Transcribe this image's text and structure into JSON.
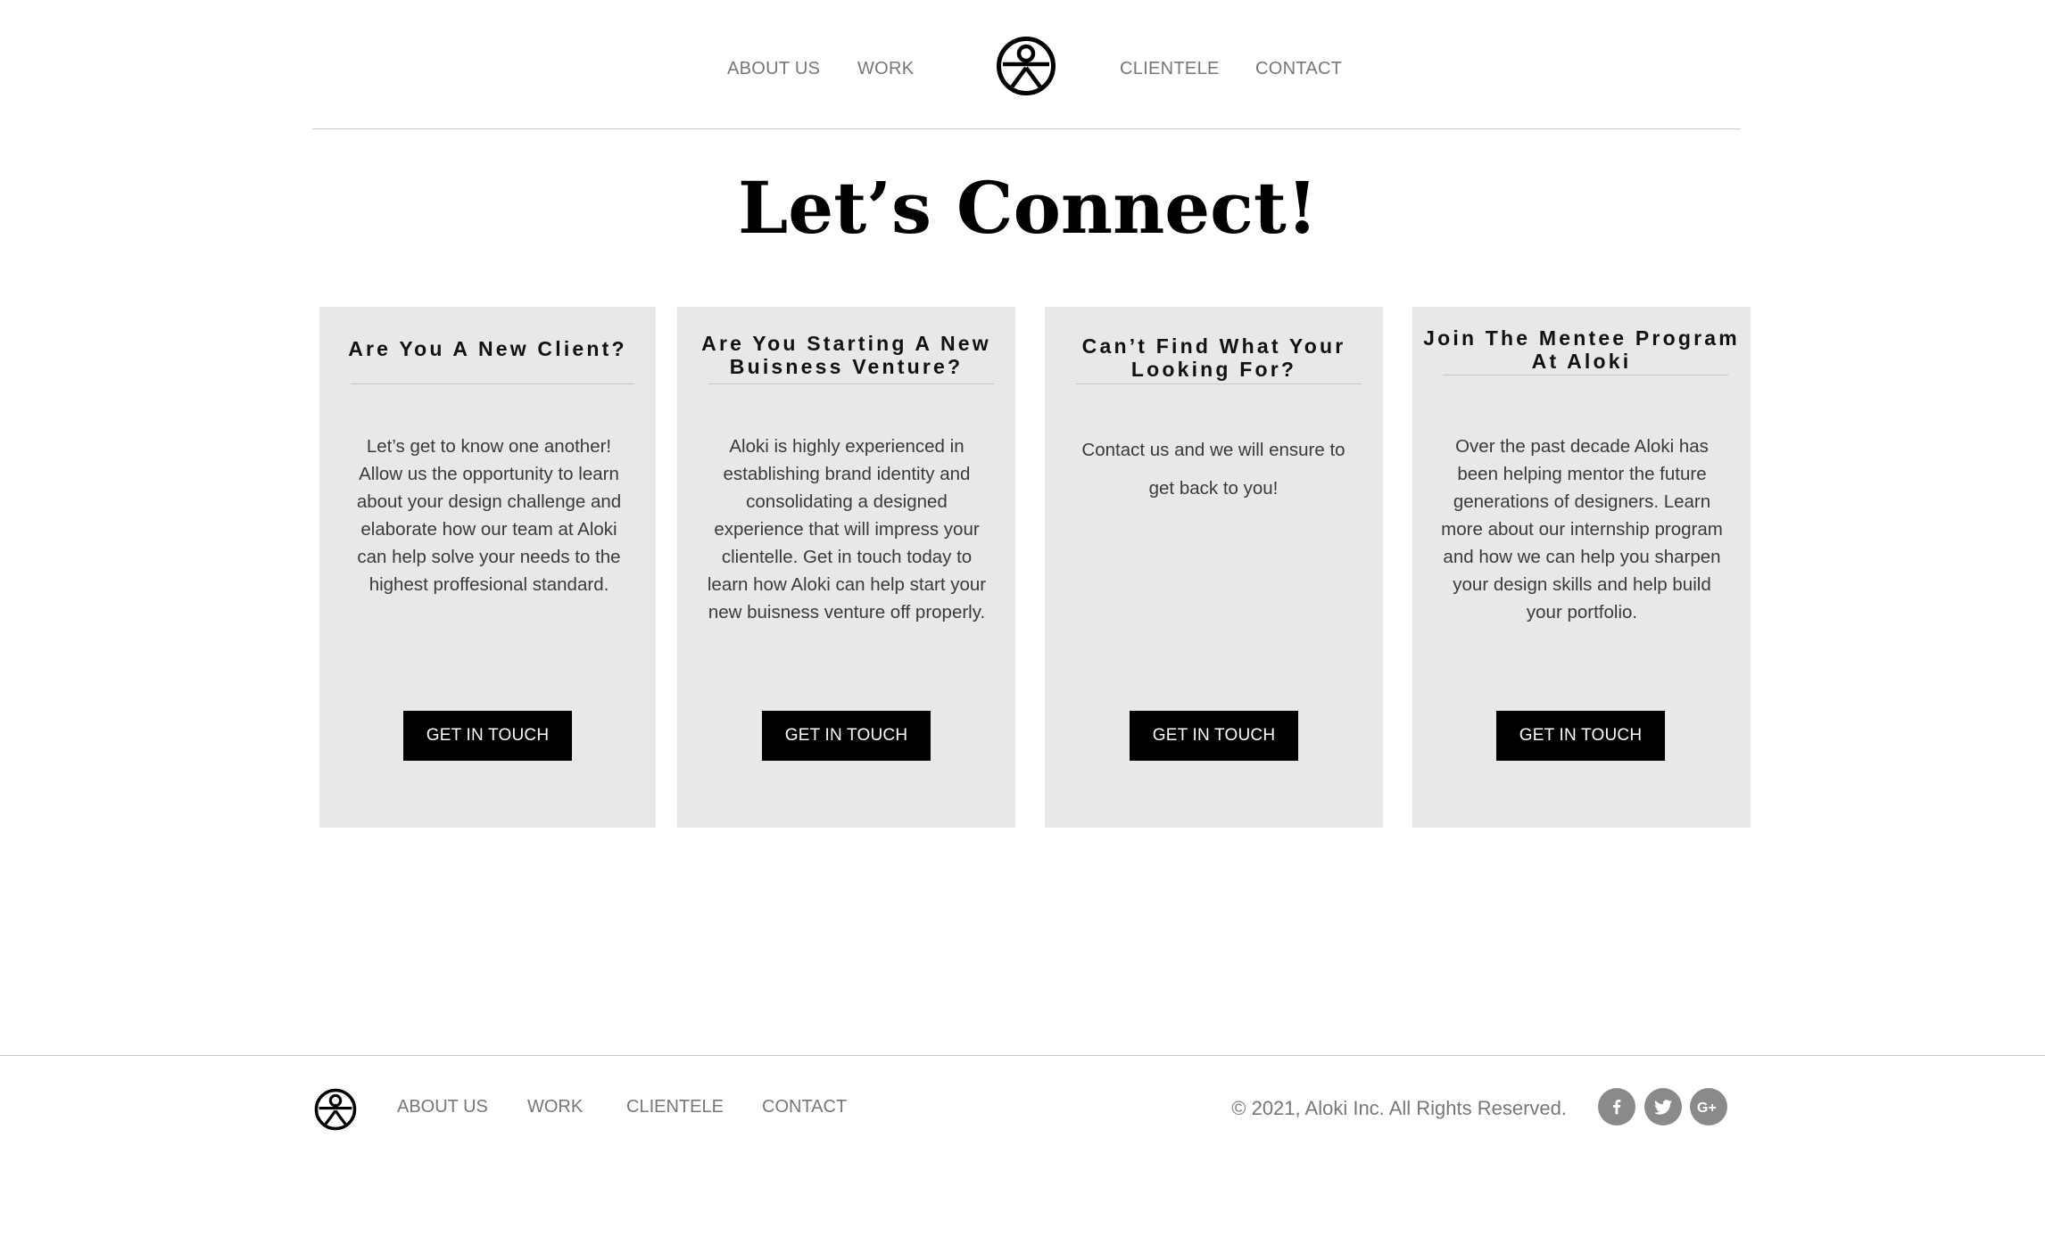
{
  "nav": {
    "about_label": "ABOUT US",
    "work_label": "WORK",
    "clientele_label": "CLIENTELE",
    "contact_label": "CONTACT",
    "logo_icon": "aloki-logo-icon"
  },
  "page": {
    "title": "Let’s Connect!"
  },
  "cards": [
    {
      "heading": "Are You A New Client?",
      "body": "Let’s get to know one another! Allow us the opportunity to learn about your design challenge and elaborate how our team at Aloki can help solve your needs to the highest proffesional standard.",
      "button_label": "GET IN TOUCH"
    },
    {
      "heading": "Are You Starting A New Buisness Venture?",
      "body": "Aloki is highly experienced in establishing brand identity and consolidating a designed experience that will impress your clientelle. Get in touch today to learn how Aloki can help start your new buisness venture off properly.",
      "button_label": "GET IN TOUCH"
    },
    {
      "heading": "Can’t Find What Your Looking For?",
      "body": "Contact us and we will ensure to get back to you!",
      "button_label": "GET IN TOUCH"
    },
    {
      "heading": "Join The Mentee Program At Aloki",
      "body": "Over the past decade Aloki has been helping mentor the future generations of designers. Learn more about our internship program and how we can help you sharpen your design skills and help build your portfolio.",
      "button_label": "GET IN TOUCH"
    }
  ],
  "footer": {
    "about_label": "ABOUT US",
    "work_label": "WORK",
    "clientele_label": "CLIENTELE",
    "contact_label": "CONTACT",
    "copyright": "© 2021, Aloki Inc. All Rights Reserved.",
    "social": [
      {
        "icon": "facebook-icon"
      },
      {
        "icon": "twitter-icon"
      },
      {
        "icon": "google-plus-icon"
      }
    ]
  },
  "colors": {
    "card_background": "#e8e8e8",
    "button_background": "#000000",
    "button_text": "#ffffff",
    "nav_text": "#777777",
    "social_background": "#8a8a8a"
  }
}
